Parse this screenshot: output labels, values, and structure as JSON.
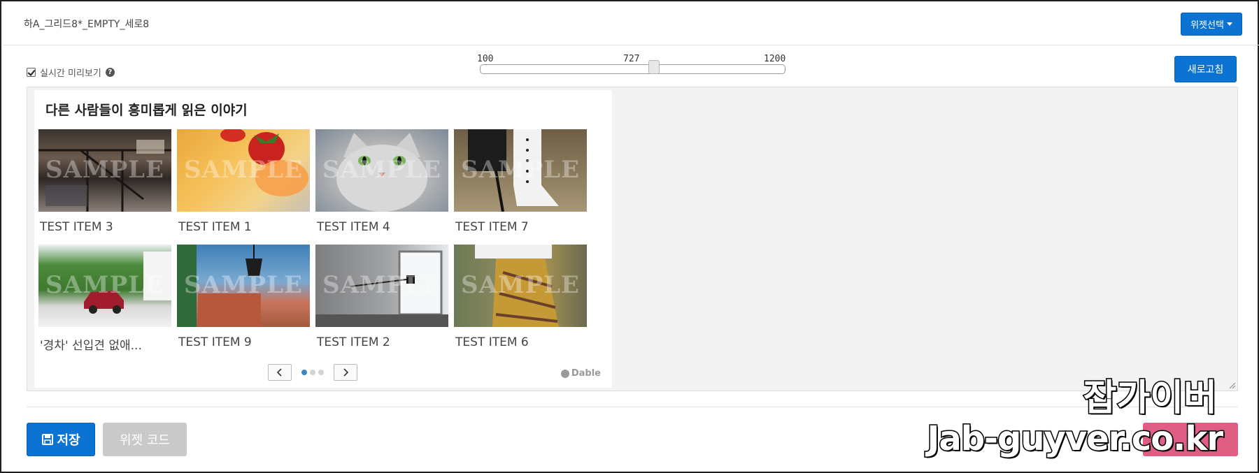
{
  "header": {
    "title": "하A_그리드8*_EMPTY_세로8",
    "widget_select_label": "위젯선택"
  },
  "toolbar": {
    "live_preview_label": "실시간 미리보기",
    "live_preview_checked": true,
    "help_glyph": "?",
    "refresh_label": "새로고침"
  },
  "width_slider": {
    "min_label": "100",
    "current_label": "727",
    "max_label": "1200",
    "min": 100,
    "max": 1200,
    "value": 727
  },
  "widget": {
    "title": "다른 사람들이 흥미롭게 읽은 이야기",
    "watermark": "SAMPLE",
    "items": [
      {
        "label": "TEST ITEM 3",
        "image": "interior-loft"
      },
      {
        "label": "TEST ITEM 1",
        "image": "strawberry-drink"
      },
      {
        "label": "TEST ITEM 4",
        "image": "grey-kitten"
      },
      {
        "label": "TEST ITEM 7",
        "image": "lace-up-boots"
      },
      {
        "label": "'경차' 선입견 없애...",
        "image": "red-car-street"
      },
      {
        "label": "TEST ITEM 9",
        "image": "lamp-town-view"
      },
      {
        "label": "TEST ITEM 2",
        "image": "grey-room-lamp"
      },
      {
        "label": "TEST ITEM 6",
        "image": "patterned-skirt"
      }
    ],
    "pager": {
      "pages": 3,
      "current": 1
    },
    "brand": "Dable"
  },
  "footer": {
    "save_label": "저장",
    "code_label": "위젯 코드"
  },
  "watermark": {
    "line1": "잡가이버",
    "line2": "Jab-guyver.co.kr"
  },
  "colors": {
    "primary": "#0d73d2",
    "disabled": "#c9c9c9",
    "danger": "#e05d84"
  }
}
